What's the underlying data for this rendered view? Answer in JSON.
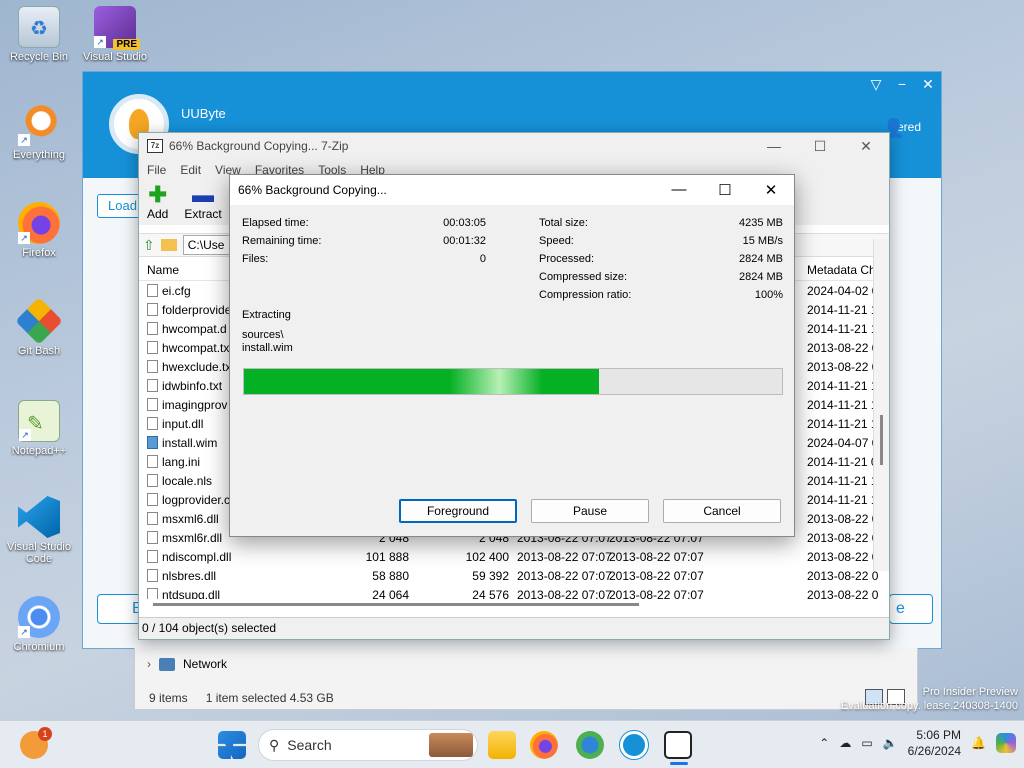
{
  "desktop": {
    "icons": [
      {
        "label": "Recycle Bin",
        "icon": "recycle-bin-icon"
      },
      {
        "label": "Visual Studio",
        "icon": "visual-studio-icon",
        "badge": "PRE"
      },
      {
        "label": "Everything",
        "icon": "everything-icon"
      },
      {
        "label": "Firefox",
        "icon": "firefox-icon"
      },
      {
        "label": "Git Bash",
        "icon": "git-bash-icon"
      },
      {
        "label": "Notepad++",
        "icon": "notepadpp-icon"
      },
      {
        "label": "Visual Studio Code",
        "icon": "vscode-icon"
      },
      {
        "label": "Chromium",
        "icon": "chromium-icon"
      }
    ]
  },
  "uubyte": {
    "name": "UUByte",
    "registered": "tered",
    "load": "Load",
    "bottom_left": "B",
    "bottom_right": "e",
    "controls": [
      "▽",
      "−",
      "✕"
    ]
  },
  "sevenzip": {
    "title": "66% Background Copying... 7-Zip",
    "menu": [
      "File",
      "Edit",
      "View",
      "Favorites",
      "Tools",
      "Help"
    ],
    "toolbar": {
      "add": "Add",
      "extract": "Extract"
    },
    "address": "C:\\Use",
    "columns": {
      "name": "Name",
      "meta": "Metadata Ch"
    },
    "files": [
      {
        "name": "ei.cfg",
        "size": "",
        "packed": "",
        "modified": "",
        "created": "",
        "meta": "2024-04-02 0"
      },
      {
        "name": "folderprovide",
        "size": "",
        "packed": "",
        "modified": "",
        "created": "",
        "meta": "2014-11-21 1"
      },
      {
        "name": "hwcompat.d",
        "size": "",
        "packed": "",
        "modified": "",
        "created": "",
        "meta": "2014-11-21 1"
      },
      {
        "name": "hwcompat.tx",
        "size": "",
        "packed": "",
        "modified": "",
        "created": "",
        "meta": "2013-08-22 0"
      },
      {
        "name": "hwexclude.tx",
        "size": "",
        "packed": "",
        "modified": "",
        "created": "",
        "meta": "2013-08-22 0"
      },
      {
        "name": "idwbinfo.txt",
        "size": "",
        "packed": "",
        "modified": "",
        "created": "",
        "meta": "2014-11-21 1"
      },
      {
        "name": "imagingprov",
        "size": "",
        "packed": "",
        "modified": "",
        "created": "",
        "meta": "2014-11-21 1"
      },
      {
        "name": "input.dll",
        "size": "",
        "packed": "",
        "modified": "",
        "created": "",
        "meta": "2014-11-21 1"
      },
      {
        "name": "install.wim",
        "size": "",
        "packed": "",
        "modified": "",
        "created": "",
        "meta": "2024-04-07 0"
      },
      {
        "name": "lang.ini",
        "size": "",
        "packed": "",
        "modified": "",
        "created": "",
        "meta": "2014-11-21 0"
      },
      {
        "name": "locale.nls",
        "size": "",
        "packed": "",
        "modified": "",
        "created": "",
        "meta": "2014-11-21 1"
      },
      {
        "name": "logprovider.c",
        "size": "",
        "packed": "",
        "modified": "",
        "created": "",
        "meta": "2014-11-21 1"
      },
      {
        "name": "msxml6.dll",
        "size": "",
        "packed": "",
        "modified": "",
        "created": "",
        "meta": "2013-08-22 0"
      },
      {
        "name": "msxml6r.dll",
        "size": "2 048",
        "packed": "2 048",
        "modified": "2013-08-22 07:07",
        "created": "2013-08-22 07:07",
        "meta": "2013-08-22 0"
      },
      {
        "name": "ndiscompl.dll",
        "size": "101 888",
        "packed": "102 400",
        "modified": "2013-08-22 07:07",
        "created": "2013-08-22 07:07",
        "meta": "2013-08-22 0"
      },
      {
        "name": "nlsbres.dll",
        "size": "58 880",
        "packed": "59 392",
        "modified": "2013-08-22 07:07",
        "created": "2013-08-22 07:07",
        "meta": "2013-08-22 0"
      },
      {
        "name": "ntdsupg.dll",
        "size": "24 064",
        "packed": "24 576",
        "modified": "2013-08-22 07:07",
        "created": "2013-08-22 07:07",
        "meta": "2013-08-22 0"
      }
    ],
    "status": "0 / 104 object(s) selected"
  },
  "dialog": {
    "title": "66% Background Copying...",
    "left_stats": [
      {
        "k": "Elapsed time:",
        "v": "00:03:05"
      },
      {
        "k": "Remaining time:",
        "v": "00:01:32"
      },
      {
        "k": "Files:",
        "v": "0"
      }
    ],
    "right_stats": [
      {
        "k": "Total size:",
        "v": "4235 MB"
      },
      {
        "k": "Speed:",
        "v": "15 MB/s"
      },
      {
        "k": "Processed:",
        "v": "2824 MB"
      },
      {
        "k": "Compressed size:",
        "v": "2824 MB"
      },
      {
        "k": "Compression ratio:",
        "v": "100%"
      }
    ],
    "operation": "Extracting",
    "path_line1": "sources\\",
    "path_line2": "install.wim",
    "progress": 0.66,
    "buttons": {
      "foreground": "Foreground",
      "pause": "Pause",
      "cancel": "Cancel"
    }
  },
  "explorer": {
    "network": "Network",
    "items": "9 items",
    "selected": "1 item selected  4.53 GB"
  },
  "watermark": {
    "line1": "Pro Insider Preview",
    "line2": "Evaluation copy. lease.240308-1400"
  },
  "taskbar": {
    "search_placeholder": "Search",
    "time": "5:06 PM",
    "date": "6/26/2024",
    "notification_count": "1"
  },
  "colors": {
    "accent": "#1691d8",
    "progress": "#06b025"
  }
}
